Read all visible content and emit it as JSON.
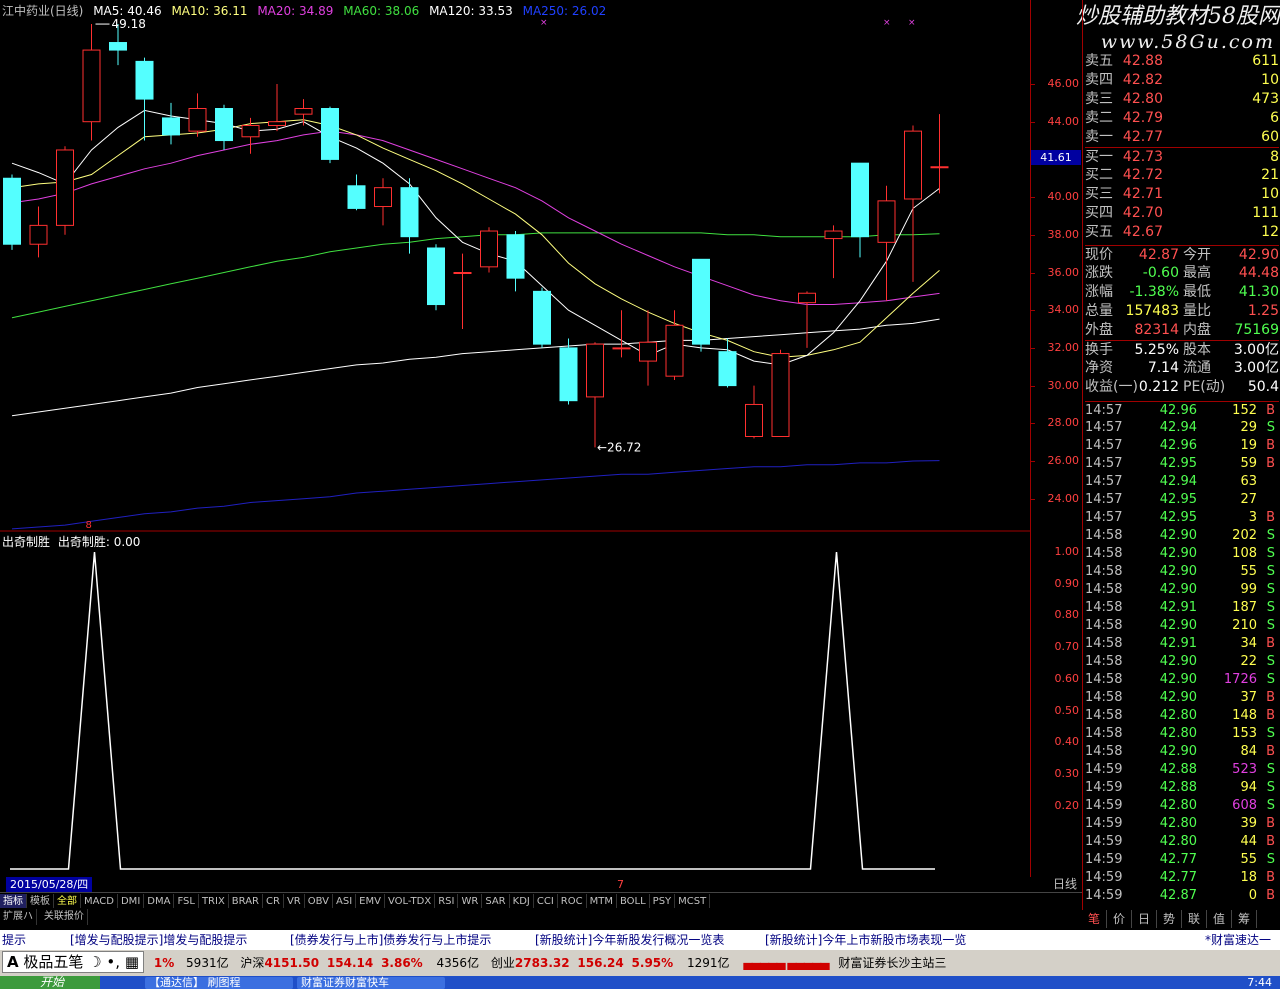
{
  "header": {
    "stock_name": "江中药业(日线)",
    "ma5": "MA5: 40.46",
    "ma10": "MA10: 36.11",
    "ma20": "MA20: 34.89",
    "ma60": "MA60: 38.06",
    "ma120": "MA120: 33.53",
    "ma250": "MA250: 26.02"
  },
  "watermark": {
    "line1": "炒股辅助教材58股网",
    "line2": "www.58Gu.com"
  },
  "annotations": {
    "high": "49.18",
    "low": "←26.72",
    "current_marker": "41.61",
    "date": "2015/05/28/四",
    "cursor_label": "7",
    "signal_marker": "8"
  },
  "price_axis": [
    "46.00",
    "44.00",
    "42.00",
    "40.00",
    "38.00",
    "36.00",
    "34.00",
    "32.00",
    "30.00",
    "28.00",
    "26.00",
    "24.00"
  ],
  "indicator": {
    "title": "出奇制胜",
    "value_label": "出奇制胜: 0.00",
    "axis": [
      "1.00",
      "0.90",
      "0.80",
      "0.70",
      "0.60",
      "0.50",
      "0.40",
      "0.30",
      "0.20"
    ]
  },
  "chart_data": {
    "type": "candlestick",
    "candles": [
      {
        "o": 41.0,
        "c": 37.5,
        "h": 41.2,
        "l": 37.2
      },
      {
        "o": 37.5,
        "c": 38.5,
        "h": 39.5,
        "l": 36.8
      },
      {
        "o": 38.5,
        "c": 42.5,
        "h": 42.7,
        "l": 38.0
      },
      {
        "o": 44.0,
        "c": 47.8,
        "h": 49.18,
        "l": 43.0
      },
      {
        "o": 48.2,
        "c": 47.8,
        "h": 49.18,
        "l": 47.0
      },
      {
        "o": 47.2,
        "c": 45.2,
        "h": 47.4,
        "l": 43.0
      },
      {
        "o": 44.2,
        "c": 43.3,
        "h": 45.0,
        "l": 42.8
      },
      {
        "o": 43.5,
        "c": 44.7,
        "h": 45.5,
        "l": 43.2
      },
      {
        "o": 44.7,
        "c": 43.0,
        "h": 44.9,
        "l": 42.5
      },
      {
        "o": 43.2,
        "c": 43.8,
        "h": 44.2,
        "l": 42.3
      },
      {
        "o": 43.8,
        "c": 44.0,
        "h": 46.0,
        "l": 43.5
      },
      {
        "o": 44.4,
        "c": 44.7,
        "h": 45.2,
        "l": 43.8
      },
      {
        "o": 44.7,
        "c": 42.0,
        "h": 44.8,
        "l": 41.8
      },
      {
        "o": 40.6,
        "c": 39.4,
        "h": 41.2,
        "l": 39.3
      },
      {
        "o": 39.5,
        "c": 40.5,
        "h": 41.0,
        "l": 38.5
      },
      {
        "o": 40.5,
        "c": 37.9,
        "h": 41.0,
        "l": 37.0
      },
      {
        "o": 37.3,
        "c": 34.3,
        "h": 37.5,
        "l": 34.0
      },
      {
        "o": 36.0,
        "c": 36.0,
        "h": 37.0,
        "l": 33.0
      },
      {
        "o": 36.3,
        "c": 38.2,
        "h": 38.4,
        "l": 36.0
      },
      {
        "o": 38.0,
        "c": 35.7,
        "h": 38.2,
        "l": 35.0
      },
      {
        "o": 35.0,
        "c": 32.2,
        "h": 35.2,
        "l": 32.0
      },
      {
        "o": 32.0,
        "c": 29.2,
        "h": 32.5,
        "l": 29.0
      },
      {
        "o": 29.4,
        "c": 32.2,
        "h": 32.3,
        "l": 26.72
      },
      {
        "o": 32.0,
        "c": 32.0,
        "h": 34.0,
        "l": 31.5
      },
      {
        "o": 31.3,
        "c": 32.3,
        "h": 34.0,
        "l": 30.0
      },
      {
        "o": 30.5,
        "c": 33.2,
        "h": 34.0,
        "l": 30.3
      },
      {
        "o": 36.7,
        "c": 32.2,
        "h": 36.7,
        "l": 31.8
      },
      {
        "o": 31.8,
        "c": 30.0,
        "h": 32.5,
        "l": 29.9
      },
      {
        "o": 27.3,
        "c": 29.0,
        "h": 30.0,
        "l": 27.2
      },
      {
        "o": 27.3,
        "c": 31.7,
        "h": 31.9,
        "l": 27.3
      },
      {
        "o": 34.4,
        "c": 34.9,
        "h": 35.0,
        "l": 32.0
      },
      {
        "o": 37.8,
        "c": 38.2,
        "h": 38.5,
        "l": 35.7
      },
      {
        "o": 41.8,
        "c": 37.9,
        "h": 41.8,
        "l": 36.8
      },
      {
        "o": 37.6,
        "c": 39.8,
        "h": 40.6,
        "l": 34.5
      },
      {
        "o": 39.9,
        "c": 43.5,
        "h": 43.8,
        "l": 35.5
      },
      {
        "o": 41.61,
        "c": 41.61,
        "h": 44.4,
        "l": 40.2
      }
    ],
    "ma5": [
      41.8,
      41.3,
      40.7,
      42.5,
      43.7,
      44.6,
      44.3,
      44.1,
      43.9,
      43.5,
      43.6,
      44.0,
      43.2,
      42.6,
      41.8,
      40.7,
      38.9,
      37.6,
      37.0,
      36.6,
      35.3,
      34.0,
      33.2,
      32.4,
      31.6,
      32.2,
      32.0,
      31.9,
      31.3,
      31.1,
      31.6,
      32.8,
      34.5,
      36.6,
      39.4,
      40.46
    ],
    "ma10": [
      40.5,
      40.7,
      40.8,
      41.2,
      42.2,
      43.2,
      43.3,
      43.4,
      43.6,
      43.9,
      44.0,
      44.1,
      43.8,
      43.3,
      42.6,
      42.0,
      41.4,
      40.7,
      39.9,
      39.1,
      38.0,
      36.5,
      35.4,
      34.6,
      33.9,
      33.3,
      32.8,
      32.4,
      31.8,
      31.5,
      31.6,
      31.9,
      32.3,
      33.6,
      34.9,
      36.11
    ],
    "ma20": [
      39.7,
      39.9,
      40.2,
      40.7,
      41.1,
      41.5,
      41.8,
      42.2,
      42.5,
      42.8,
      43.0,
      43.3,
      43.5,
      43.3,
      43.0,
      42.5,
      42.0,
      41.5,
      41.0,
      40.5,
      39.8,
      38.9,
      38.2,
      37.5,
      36.9,
      36.3,
      35.8,
      35.3,
      34.8,
      34.5,
      34.3,
      34.3,
      34.4,
      34.5,
      34.7,
      34.89
    ],
    "ma60": [
      33.6,
      33.9,
      34.2,
      34.5,
      34.8,
      35.1,
      35.4,
      35.7,
      36.0,
      36.3,
      36.6,
      36.8,
      37.1,
      37.3,
      37.5,
      37.6,
      37.8,
      37.9,
      38.0,
      38.0,
      38.1,
      38.1,
      38.1,
      38.1,
      38.1,
      38.1,
      38.1,
      38.0,
      38.0,
      37.9,
      37.9,
      37.9,
      37.9,
      38.0,
      38.0,
      38.06
    ],
    "ma120": [
      28.4,
      28.6,
      28.8,
      29.0,
      29.2,
      29.4,
      29.6,
      29.9,
      30.1,
      30.3,
      30.5,
      30.7,
      30.9,
      31.1,
      31.2,
      31.4,
      31.5,
      31.7,
      31.8,
      31.9,
      32.0,
      32.1,
      32.2,
      32.2,
      32.3,
      32.4,
      32.4,
      32.5,
      32.6,
      32.7,
      32.8,
      32.9,
      33.0,
      33.2,
      33.3,
      33.53
    ],
    "ma250": [
      22.4,
      22.5,
      22.6,
      22.8,
      23.0,
      23.2,
      23.3,
      23.5,
      23.6,
      23.8,
      23.9,
      24.0,
      24.1,
      24.3,
      24.4,
      24.5,
      24.6,
      24.7,
      24.8,
      24.9,
      25.0,
      25.1,
      25.2,
      25.3,
      25.3,
      25.4,
      25.5,
      25.6,
      25.7,
      25.7,
      25.8,
      25.8,
      25.9,
      25.9,
      26.0,
      26.02
    ],
    "indicator_values": [
      0,
      0,
      0,
      1,
      0,
      0,
      0,
      0,
      0,
      0,
      0,
      0,
      0,
      0,
      0,
      0,
      0,
      0,
      0,
      0,
      0,
      0,
      0,
      0,
      0,
      0,
      0,
      0,
      0,
      0,
      0,
      1,
      0,
      0,
      0,
      0
    ],
    "ylim": [
      22.0,
      49.8
    ],
    "colors": {
      "up": "#ff3030",
      "down": "#54ffff",
      "ma5": "#ffffff",
      "ma10": "#ffff80",
      "ma20": "#e040e0",
      "ma60": "#40e040",
      "ma120": "#ffffff",
      "ma250": "#2020c0"
    }
  },
  "order_book": [
    {
      "label": "卖五",
      "price": "42.88",
      "vol": "611"
    },
    {
      "label": "卖四",
      "price": "42.82",
      "vol": "10"
    },
    {
      "label": "卖三",
      "price": "42.80",
      "vol": "473"
    },
    {
      "label": "卖二",
      "price": "42.79",
      "vol": "6"
    },
    {
      "label": "卖一",
      "price": "42.77",
      "vol": "60"
    },
    {
      "label": "买一",
      "price": "42.73",
      "vol": "8"
    },
    {
      "label": "买二",
      "price": "42.72",
      "vol": "21"
    },
    {
      "label": "买三",
      "price": "42.71",
      "vol": "10"
    },
    {
      "label": "买四",
      "price": "42.70",
      "vol": "111"
    },
    {
      "label": "买五",
      "price": "42.67",
      "vol": "12"
    }
  ],
  "stats": [
    {
      "l1": "现价",
      "v1": "42.87",
      "l2": "今开",
      "v2": "42.90",
      "c1": "#ff5050",
      "c2": "#ff5050"
    },
    {
      "l1": "涨跌",
      "v1": "-0.60",
      "l2": "最高",
      "v2": "44.48",
      "c1": "#50ff50",
      "c2": "#ff5050"
    },
    {
      "l1": "涨幅",
      "v1": "-1.38%",
      "l2": "最低",
      "v2": "41.30",
      "c1": "#50ff50",
      "c2": "#50ff50"
    },
    {
      "l1": "总量",
      "v1": "157483",
      "l2": "量比",
      "v2": "1.25",
      "c1": "#ffff50",
      "c2": "#ff5050"
    },
    {
      "l1": "外盘",
      "v1": "82314",
      "l2": "内盘",
      "v2": "75169",
      "c1": "#ff5050",
      "c2": "#50ff50"
    },
    {
      "l1": "换手",
      "v1": "5.25%",
      "l2": "股本",
      "v2": "3.00亿",
      "c1": "#ffffff",
      "c2": "#ffffff"
    },
    {
      "l1": "净资",
      "v1": "7.14",
      "l2": "流通",
      "v2": "3.00亿",
      "c1": "#ffffff",
      "c2": "#ffffff"
    },
    {
      "l1": "收益(一)",
      "v1": "0.212",
      "l2": "PE(动)",
      "v2": "50.4",
      "c1": "#ffffff",
      "c2": "#ffffff"
    }
  ],
  "ticks": [
    {
      "t": "14:57",
      "p": "42.96",
      "v": "152",
      "d": "B"
    },
    {
      "t": "14:57",
      "p": "42.94",
      "v": "29",
      "d": "S"
    },
    {
      "t": "14:57",
      "p": "42.96",
      "v": "19",
      "d": "B"
    },
    {
      "t": "14:57",
      "p": "42.95",
      "v": "59",
      "d": "B"
    },
    {
      "t": "14:57",
      "p": "42.94",
      "v": "63",
      "d": ""
    },
    {
      "t": "14:57",
      "p": "42.95",
      "v": "27",
      "d": ""
    },
    {
      "t": "14:57",
      "p": "42.95",
      "v": "3",
      "d": "B"
    },
    {
      "t": "14:58",
      "p": "42.90",
      "v": "202",
      "d": "S"
    },
    {
      "t": "14:58",
      "p": "42.90",
      "v": "108",
      "d": "S"
    },
    {
      "t": "14:58",
      "p": "42.90",
      "v": "55",
      "d": "S"
    },
    {
      "t": "14:58",
      "p": "42.90",
      "v": "99",
      "d": "S"
    },
    {
      "t": "14:58",
      "p": "42.91",
      "v": "187",
      "d": "S"
    },
    {
      "t": "14:58",
      "p": "42.90",
      "v": "210",
      "d": "S"
    },
    {
      "t": "14:58",
      "p": "42.91",
      "v": "34",
      "d": "B"
    },
    {
      "t": "14:58",
      "p": "42.90",
      "v": "22",
      "d": "S"
    },
    {
      "t": "14:58",
      "p": "42.90",
      "v": "1726",
      "d": "S"
    },
    {
      "t": "14:58",
      "p": "42.90",
      "v": "37",
      "d": "B"
    },
    {
      "t": "14:58",
      "p": "42.80",
      "v": "148",
      "d": "B"
    },
    {
      "t": "14:58",
      "p": "42.80",
      "v": "153",
      "d": "S"
    },
    {
      "t": "14:58",
      "p": "42.90",
      "v": "84",
      "d": "B"
    },
    {
      "t": "14:59",
      "p": "42.88",
      "v": "523",
      "d": "S"
    },
    {
      "t": "14:59",
      "p": "42.88",
      "v": "94",
      "d": "S"
    },
    {
      "t": "14:59",
      "p": "42.80",
      "v": "608",
      "d": "S"
    },
    {
      "t": "14:59",
      "p": "42.80",
      "v": "39",
      "d": "B"
    },
    {
      "t": "14:59",
      "p": "42.80",
      "v": "44",
      "d": "B"
    },
    {
      "t": "14:59",
      "p": "42.77",
      "v": "55",
      "d": "S"
    },
    {
      "t": "14:59",
      "p": "42.77",
      "v": "18",
      "d": "B"
    },
    {
      "t": "14:59",
      "p": "42.87",
      "v": "0",
      "d": "B"
    }
  ],
  "indicator_tabs": [
    "指标",
    "模板",
    "全部",
    "MACD",
    "DMI",
    "DMA",
    "FSL",
    "TRIX",
    "BRAR",
    "CR",
    "VR",
    "OBV",
    "ASI",
    "EMV",
    "VOL-TDX",
    "RSI",
    "WR",
    "SAR",
    "KDJ",
    "CCI",
    "ROC",
    "MTM",
    "BOLL",
    "PSY",
    "MCST"
  ],
  "zoom": {
    "plus": "+",
    "minus": "-",
    "period_label": "日线"
  },
  "status_links": [
    "扩展ハ",
    "关联报价"
  ],
  "panel_tabs": [
    "笔",
    "价",
    "日",
    "势",
    "联",
    "值",
    "筹"
  ],
  "news": [
    "提示",
    "[增发与配股提示]增发与配股提示",
    "[债券发行与上市]债券发行与上市提示",
    "[新股统计]今年新股发行概况一览表",
    "[新股统计]今年上市新股市场表现一览",
    "*财富速达一"
  ],
  "index_bar": {
    "ime": "极品五笔",
    "seg1": "1%",
    "amt1": "5931亿",
    "hs_label": "沪深",
    "hs_value": "4151.50",
    "hs_change": "154.14",
    "hs_pct": "3.86%",
    "amt2": "4356亿",
    "cy_label": "创业",
    "cy_value": "2783.32",
    "cy_change": "156.24",
    "cy_pct": "5.95%",
    "amt3": "1291亿",
    "broker": "财富证券长沙主站三"
  },
  "taskbar": {
    "start": "开始",
    "items": [
      "【通达信】 刷图程",
      "财富证券财富快车"
    ],
    "clock": "7:44"
  }
}
